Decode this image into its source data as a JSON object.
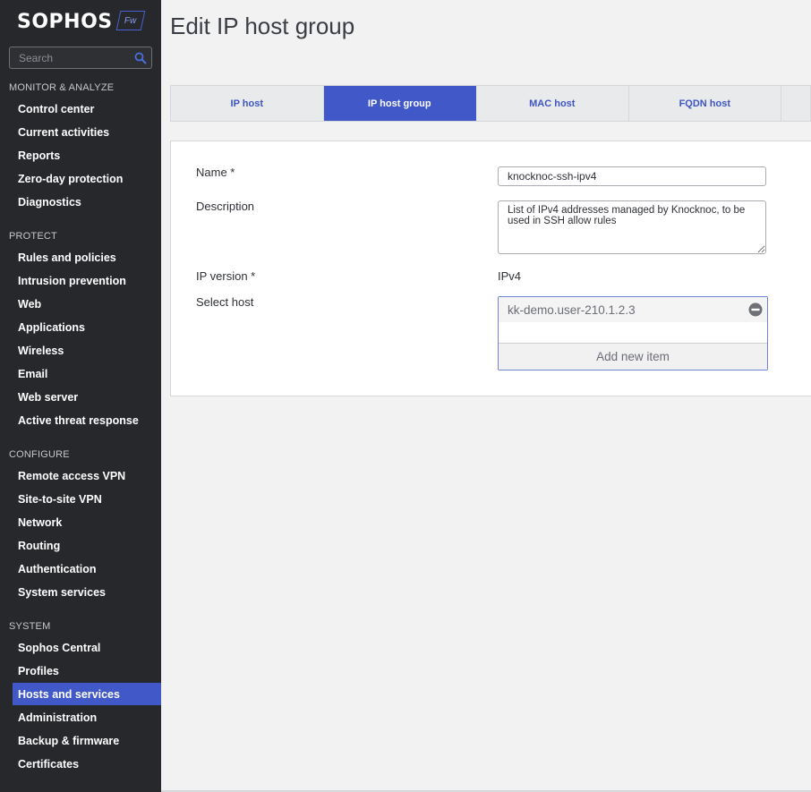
{
  "brand": {
    "name": "SOPHOS",
    "badge": "Fw"
  },
  "search": {
    "placeholder": "Search"
  },
  "sidebar": {
    "sections": [
      {
        "title": "MONITOR & ANALYZE",
        "items": [
          "Control center",
          "Current activities",
          "Reports",
          "Zero-day protection",
          "Diagnostics"
        ]
      },
      {
        "title": "PROTECT",
        "items": [
          "Rules and policies",
          "Intrusion prevention",
          "Web",
          "Applications",
          "Wireless",
          "Email",
          "Web server",
          "Active threat response"
        ]
      },
      {
        "title": "CONFIGURE",
        "items": [
          "Remote access VPN",
          "Site-to-site VPN",
          "Network",
          "Routing",
          "Authentication",
          "System services"
        ]
      },
      {
        "title": "SYSTEM",
        "items": [
          "Sophos Central",
          "Profiles",
          "Hosts and services",
          "Administration",
          "Backup & firmware",
          "Certificates"
        ]
      }
    ],
    "active_item": "Hosts and services"
  },
  "page": {
    "title": "Edit IP host group"
  },
  "tabs": [
    {
      "label": "IP host",
      "active": false
    },
    {
      "label": "IP host group",
      "active": true
    },
    {
      "label": "MAC host",
      "active": false
    },
    {
      "label": "FQDN host",
      "active": false
    }
  ],
  "form": {
    "name_label": "Name *",
    "name_value": "knocknoc-ssh-ipv4",
    "description_label": "Description",
    "description_value": "List of IPv4 addresses managed by Knocknoc, to be used in SSH allow rules",
    "ip_version_label": "IP version *",
    "ip_version_value": "IPv4",
    "select_host_label": "Select host",
    "hosts": [
      "kk-demo.user-210.1.2.3"
    ],
    "add_item_label": "Add new item"
  },
  "colors": {
    "sidebar_bg": "#26282c",
    "accent": "#4158c8",
    "tab_text": "#3d55c4"
  },
  "icons": {
    "search": "search-icon",
    "remove": "minus-circle-icon"
  }
}
